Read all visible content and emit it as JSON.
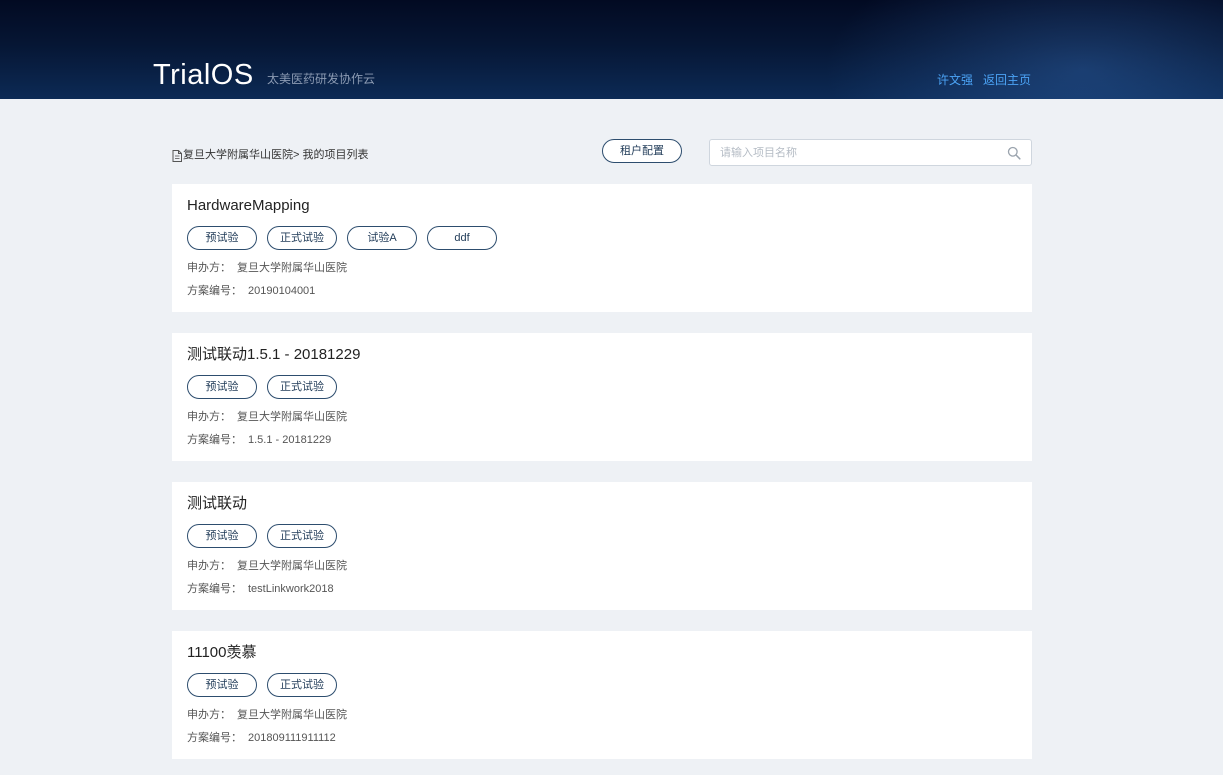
{
  "header": {
    "logo": "TrialOS",
    "tagline": "太美医药研发协作云",
    "user_name": "许文强",
    "home_link": "返回主页"
  },
  "toolbar": {
    "breadcrumb_org": "复旦大学附属华山医院",
    "breadcrumb_sep": "> ",
    "breadcrumb_page": "我的项目列表",
    "config_button": "租户配置",
    "search_placeholder": "请输入项目名称"
  },
  "labels": {
    "sponsor": "申办方：",
    "protocol": "方案编号："
  },
  "projects": [
    {
      "title": "HardwareMapping",
      "tags": [
        "预试验",
        "正式试验",
        "试验A",
        "ddf"
      ],
      "sponsor": "复旦大学附属华山医院",
      "protocol_no": "20190104001"
    },
    {
      "title": "测试联动1.5.1 - 20181229",
      "tags": [
        "预试验",
        "正式试验"
      ],
      "sponsor": "复旦大学附属华山医院",
      "protocol_no": "1.5.1 - 20181229"
    },
    {
      "title": "测试联动",
      "tags": [
        "预试验",
        "正式试验"
      ],
      "sponsor": "复旦大学附属华山医院",
      "protocol_no": "testLinkwork2018"
    },
    {
      "title": "11100羡慕",
      "tags": [
        "预试验",
        "正式试验"
      ],
      "sponsor": "复旦大学附属华山医院",
      "protocol_no": "201809111911112"
    }
  ],
  "colors": {
    "header_bg": "#061634",
    "accent_link": "#4ba3f5",
    "tag_border": "#2d4d6e",
    "page_bg": "#eef1f5"
  },
  "icons": {
    "breadcrumb": "document-icon",
    "search": "search-icon"
  }
}
